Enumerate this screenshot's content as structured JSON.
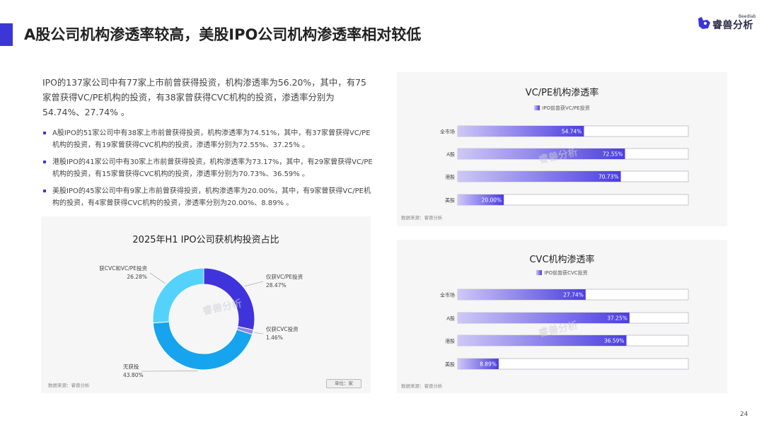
{
  "header": {
    "title": "A股公司机构渗透率较高，美股IPO公司机构渗透率相对较低",
    "logo_text": "睿兽分析",
    "logo_sup": "Beedlab"
  },
  "text": {
    "intro": "IPO的137家公司中有77家上市前曾获得投资，机构渗透率为56.20%，其中，有75家曾获得VC/PE机构的投资，有38家曾获得CVC机构的投资，渗透率分别为54.74%、27.74% 。",
    "bullets": [
      "A股IPO的51家公司中有38家上市前曾获得投资，机构渗透率为74.51%，其中，有37家曾获得VC/PE机构的投资，有19家曾获得CVC机构的投资，渗透率分别为72.55%、37.25% 。",
      "港股IPO的41家公司中有30家上市前曾获得投资，机构渗透率为73.17%，其中，有29家曾获得VC/PE机构的投资，有15家曾获得CVC机构的投资，渗透率分别为70.73%、36.59% 。",
      "美股IPO的45家公司中有9家上市前曾获得投资，机构渗透率为20.00%，其中，有9家曾获得VC/PE机构的投资，有4家曾获得CVC机构的投资，渗透率分别为20.00%、8.89% 。"
    ]
  },
  "source_text": "数据来源：睿兽分析",
  "unit_button": "单位：家",
  "watermark": "睿兽分析",
  "page_number": "24",
  "colors": {
    "accent": "#3b36d6",
    "bar_start": "#cfc8f5",
    "bar_end": "#4b3ee0",
    "pie_vcpe": "#3f34dc",
    "pie_cvc": "#8e87ea",
    "pie_none": "#17a4ee",
    "pie_both": "#55d2fb"
  },
  "chart_data": [
    {
      "type": "pie",
      "variant": "donut",
      "title": "2025年H1 IPO公司获机构投资占比",
      "slices": [
        {
          "label": "仅获VC/PE投资",
          "value": 28.47,
          "display": "28.47%",
          "color": "#3f34dc"
        },
        {
          "label": "仅获CVC投资",
          "value": 1.46,
          "display": "1.46%",
          "color": "#8e87ea"
        },
        {
          "label": "无获投",
          "value": 43.8,
          "display": "43.80%",
          "color": "#17a4ee"
        },
        {
          "label": "获CVC和VC/PE投资",
          "value": 26.28,
          "display": "26.28%",
          "color": "#55d2fb"
        }
      ]
    },
    {
      "type": "bar",
      "orientation": "horizontal",
      "title": "VC/PE机构渗透率",
      "legend": "IPO前曾获VC/PE投资",
      "categories": [
        "全市场",
        "A股",
        "港股",
        "美股"
      ],
      "values": [
        54.74,
        72.55,
        70.73,
        20.0
      ],
      "value_labels": [
        "54.74%",
        "72.55%",
        "70.73%",
        "20.00%"
      ],
      "xlim": [
        0,
        100
      ]
    },
    {
      "type": "bar",
      "orientation": "horizontal",
      "title": "CVC机构渗透率",
      "legend": "IPO前曾获CVC投资",
      "categories": [
        "全市场",
        "A股",
        "港股",
        "美股"
      ],
      "values": [
        27.74,
        37.25,
        36.59,
        8.89
      ],
      "value_labels": [
        "27.74%",
        "37.25%",
        "36.59%",
        "8.89%"
      ],
      "xlim": [
        0,
        50
      ]
    }
  ]
}
